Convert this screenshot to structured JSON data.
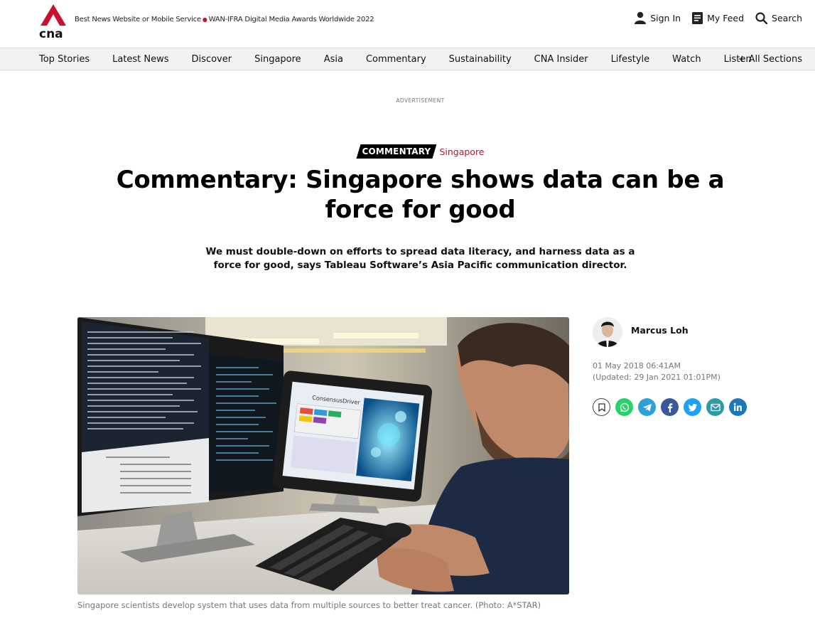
{
  "header": {
    "award_text": "Best News Website or Mobile Service",
    "award_text2": "WAN-IFRA Digital Media Awards Worldwide 2022",
    "sign_in": "Sign In",
    "my_feed": "My Feed",
    "search": "Search"
  },
  "nav": {
    "items": [
      "Top Stories",
      "Latest News",
      "Discover",
      "Singapore",
      "Asia",
      "Commentary",
      "Sustainability",
      "CNA Insider",
      "Lifestyle",
      "Watch",
      "Listen"
    ],
    "all_sections": "+ All Sections"
  },
  "advertisement_label": "ADVERTISEMENT",
  "article": {
    "category": "COMMENTARY",
    "subcategory": "Singapore",
    "title": "Commentary: Singapore shows data can be a force for good",
    "standfirst": "We must double-down on efforts to spread data literacy, and harness data as a force for good, says Tableau Software’s Asia Pacific communication director.",
    "image_caption": "Singapore scientists develop system that uses data from multiple sources to better treat cancer. (Photo: A*STAR)",
    "photo_screen_label": "ConsensusDriver",
    "author": "Marcus Loh",
    "published": "01 May 2018 06:41AM",
    "updated": "(Updated: 29 Jan 2021 01:01PM)"
  },
  "share": [
    {
      "name": "bookmark-icon",
      "color": "#ffffff"
    },
    {
      "name": "whatsapp-icon",
      "color": "#25d366"
    },
    {
      "name": "telegram-icon",
      "color": "#2ea0d9"
    },
    {
      "name": "facebook-icon",
      "color": "#3b5998"
    },
    {
      "name": "twitter-icon",
      "color": "#1da1f2"
    },
    {
      "name": "email-icon",
      "color": "#2e9aa8"
    },
    {
      "name": "linkedin-icon",
      "color": "#1e78b4"
    }
  ],
  "colors": {
    "brand_red": "#c8102e",
    "nav_bg": "#f2f2f2"
  }
}
